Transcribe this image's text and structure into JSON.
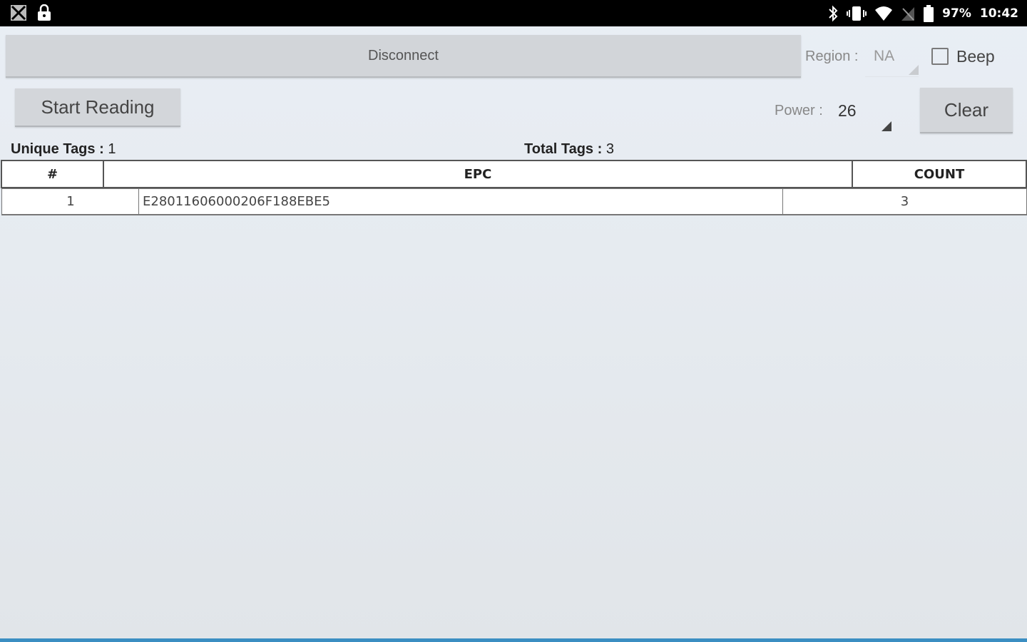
{
  "status_bar": {
    "icons_left": [
      "image-icon",
      "lock-icon"
    ],
    "icons_right": [
      "bluetooth-icon",
      "vibrate-icon",
      "wifi-icon",
      "no-signal-icon",
      "battery-icon"
    ],
    "battery": "97%",
    "time": "10:42"
  },
  "disconnect_label": "Disconnect",
  "region": {
    "label": "Region :",
    "value": "NA"
  },
  "beep": {
    "label": "Beep",
    "checked": false
  },
  "start_label": "Start Reading",
  "power": {
    "label": "Power :",
    "value": "26"
  },
  "clear_label": "Clear",
  "counts": {
    "unique_label": "Unique Tags :",
    "unique_value": "1",
    "total_label": "Total Tags :",
    "total_value": "3"
  },
  "table": {
    "headers": [
      "#",
      "EPC",
      "COUNT"
    ],
    "rows": [
      {
        "index": "1",
        "epc": "E28011606000206F188EBE5",
        "count": "3"
      }
    ]
  },
  "colors": {
    "status_bar": "#000000",
    "bottom_accent": "#3b8ec2",
    "button": "#d3d6da"
  }
}
